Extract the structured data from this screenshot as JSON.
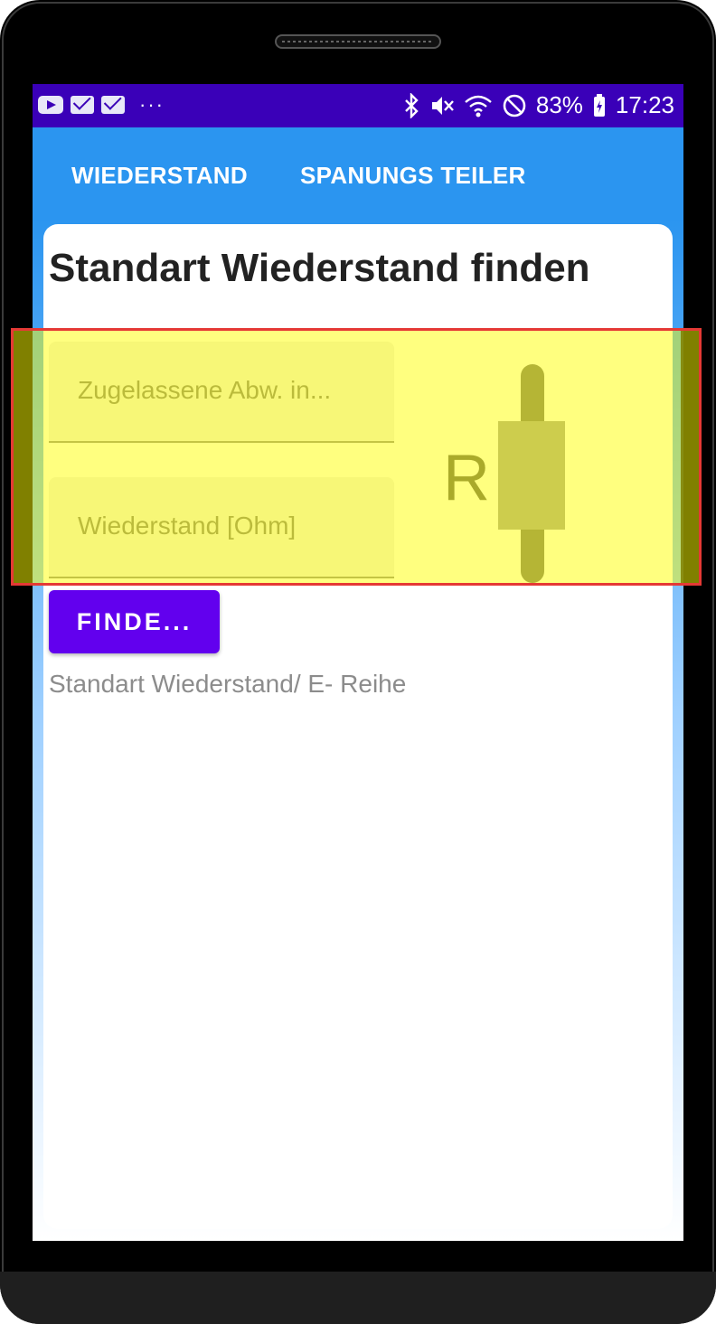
{
  "status_bar": {
    "left_icons": [
      "youtube-icon",
      "mail-icon",
      "mail-icon",
      "more-dots-icon"
    ],
    "battery": "83%",
    "time": "17:23",
    "right_icons": [
      "bluetooth-icon",
      "mute-icon",
      "wifi-icon",
      "do-not-disturb-icon",
      "battery-icon"
    ]
  },
  "tabs": [
    {
      "label": "WIEDERSTAND"
    },
    {
      "label": "SPANUNGS TEILER"
    }
  ],
  "card": {
    "title": "Standart Wiederstand finden",
    "fields": [
      {
        "placeholder": "Zugelassene Abw. in..."
      },
      {
        "placeholder": "Wiederstand [Ohm]"
      }
    ],
    "resistor_label": "R",
    "button_label": "FINDE...",
    "result_text": "Standart Wiederstand/ E- Reihe"
  },
  "colors": {
    "status_bar": "#3a00b8",
    "app_bar": "#2b95f0",
    "button": "#6200ee",
    "highlight_border": "#e53935",
    "highlight_fill": "#ffff00"
  }
}
